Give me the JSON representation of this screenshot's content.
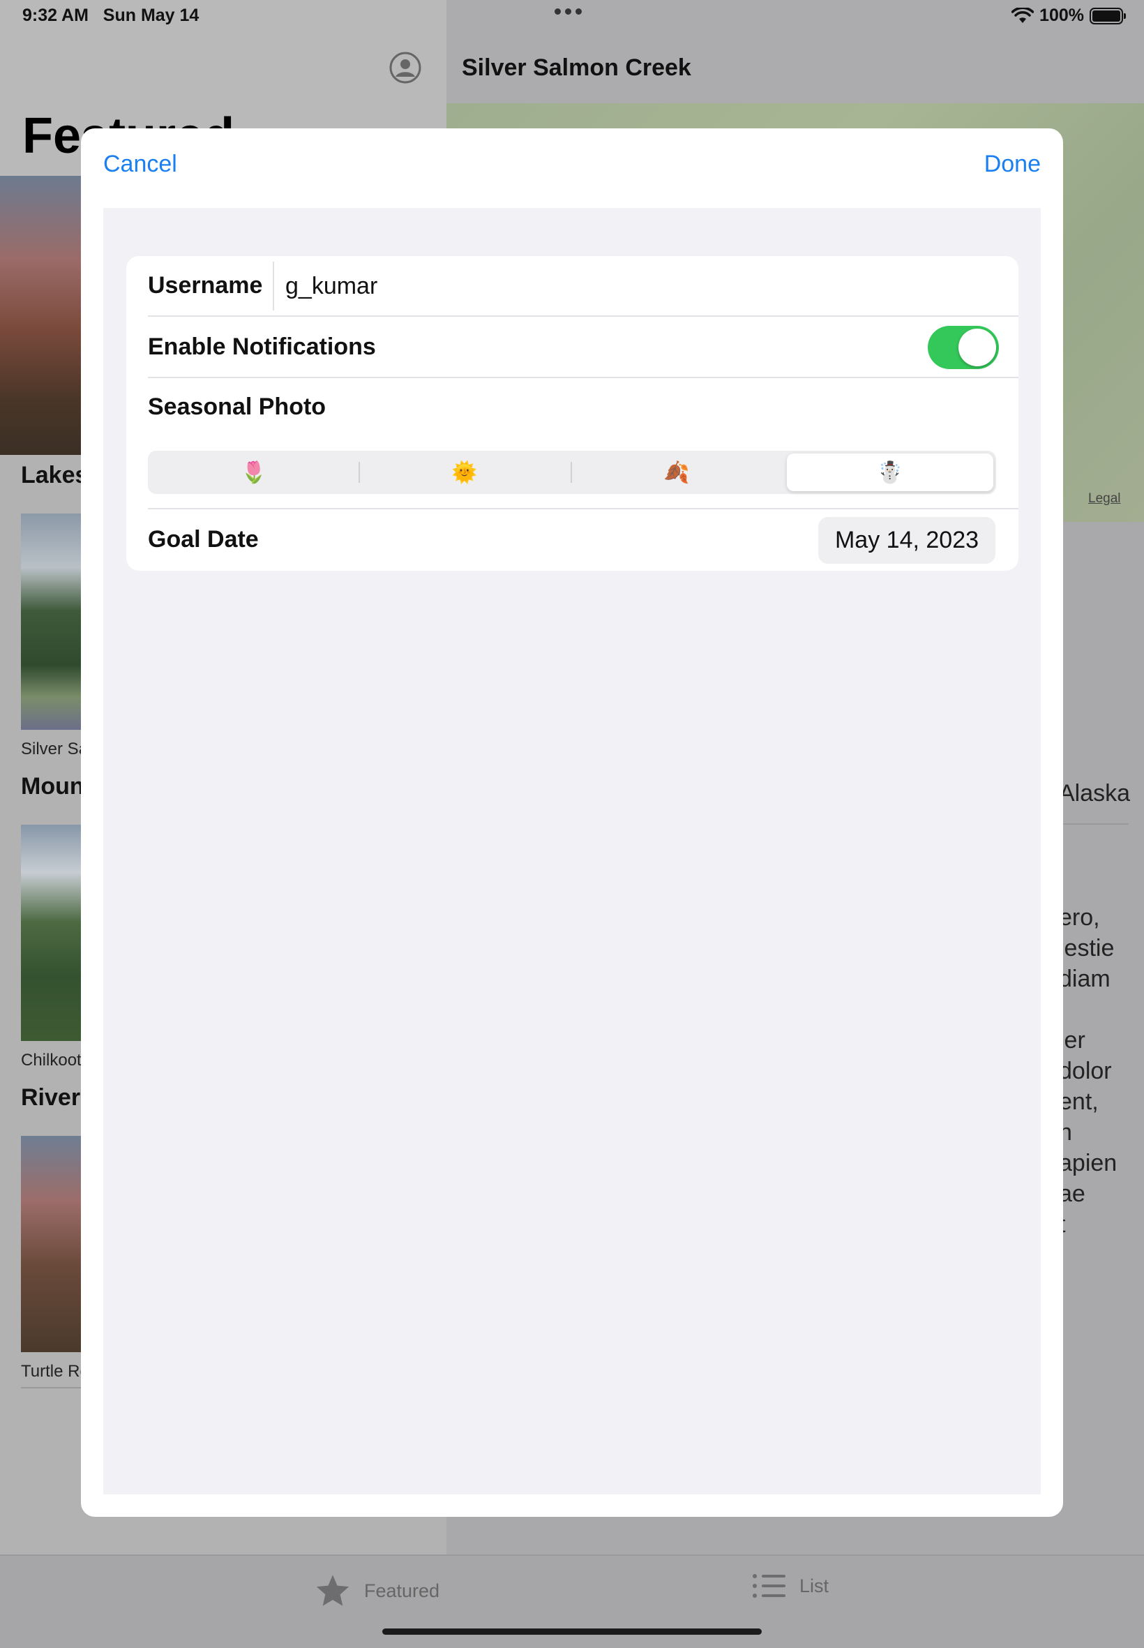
{
  "status_bar": {
    "time": "9:32 AM",
    "date": "Sun May 14",
    "battery": "100%"
  },
  "background": {
    "featured_title": "Featured",
    "sections": [
      {
        "title": "Lakes",
        "item": "Silver Salmon Creek"
      },
      {
        "title": "Mountains",
        "item": "Chilkoot Trail"
      },
      {
        "title": "Rivers",
        "item": "Turtle Rock"
      }
    ],
    "detail_title": "Silver Salmon Creek",
    "map_legal": "Legal",
    "detail_fragments": [
      "Alaska",
      "ero,",
      "lestie",
      "diam",
      "ier",
      "dolor",
      "ent,",
      "n",
      "apien",
      "ae",
      "t"
    ]
  },
  "sheet": {
    "cancel_label": "Cancel",
    "done_label": "Done",
    "username_label": "Username",
    "username_value": "g_kumar",
    "notifications_label": "Enable Notifications",
    "notifications_enabled": true,
    "seasonal_label": "Seasonal Photo",
    "seasons": [
      {
        "emoji": "🌷",
        "icon": "tulip-icon"
      },
      {
        "emoji": "🌞",
        "icon": "sun-icon"
      },
      {
        "emoji": "🍂",
        "icon": "fallen-leaves-icon"
      },
      {
        "emoji": "☃️",
        "icon": "snowman-icon"
      }
    ],
    "selected_season_index": 3,
    "goal_date_label": "Goal Date",
    "goal_date_value": "May 14, 2023"
  },
  "tabs": [
    {
      "label": "Featured",
      "icon": "star-icon"
    },
    {
      "label": "List",
      "icon": "list-icon"
    }
  ]
}
